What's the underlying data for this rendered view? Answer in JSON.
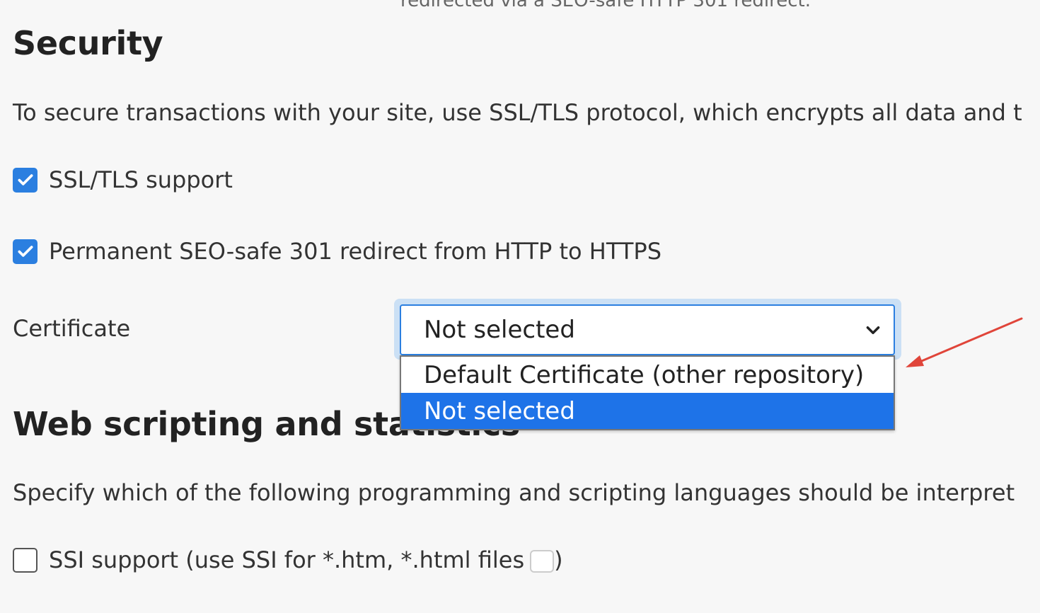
{
  "top_cut_text": "redirected via a SEO-safe HTTP 301 redirect.",
  "security": {
    "title": "Security",
    "description": "To secure transactions with your site, use SSL/TLS protocol, which encrypts all data and t",
    "ssl_support": {
      "label": "SSL/TLS support",
      "checked": true
    },
    "redirect": {
      "label": "Permanent SEO-safe 301 redirect from HTTP to HTTPS",
      "checked": true
    },
    "certificate": {
      "label": "Certificate",
      "selected": "Not selected",
      "options": [
        {
          "label": "Default Certificate (other repository)",
          "selected": false
        },
        {
          "label": "Not selected",
          "selected": true
        }
      ]
    }
  },
  "web_scripting": {
    "title": "Web scripting and statistics",
    "description": "Specify which of the following programming and scripting languages should be interpret",
    "ssi": {
      "label": "SSI support (use SSI for *.htm, *.html files",
      "suffix": ")",
      "checked": false
    }
  },
  "colors": {
    "accent": "#2b7fe0",
    "option_highlight": "#1e73e8",
    "annotation_arrow": "#e0453a"
  }
}
